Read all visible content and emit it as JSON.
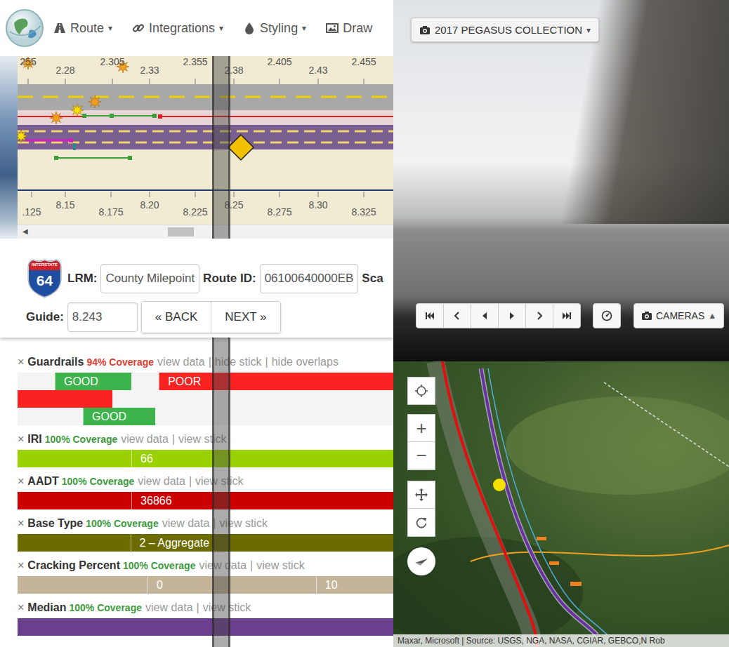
{
  "nav": {
    "menus": [
      {
        "label": "Route",
        "caret": "▾"
      },
      {
        "label": "Integrations",
        "caret": "▾"
      },
      {
        "label": "Styling",
        "caret": "▾"
      },
      {
        "label": "Draw"
      }
    ]
  },
  "diagram": {
    "top_scale": [
      "255",
      "2.28",
      "2.305",
      "2.33",
      "2.355",
      "2.38",
      "2.405",
      "2.43",
      "2.455"
    ],
    "bottom_scale": [
      ".125",
      "8.15",
      "8.175",
      "8.20",
      "8.225",
      "8.25",
      "8.275",
      "8.30",
      "8.325"
    ],
    "scroll_left": "◀",
    "scroll_level": 0.4
  },
  "route": {
    "shield_top": "INTERSTATE",
    "shield_number": "64",
    "lrm_label": "LRM:",
    "lrm_value": "County Milepoint",
    "route_id_label": "Route ID:",
    "route_id_value": "06100640000EB",
    "scale_label": "Sca",
    "guide_label": "Guide:",
    "guide_value": "8.243",
    "back": "« BACK",
    "next": "NEXT »"
  },
  "sticks": [
    {
      "close": "×",
      "name": "Guardrails",
      "coverage": "94% Coverage",
      "coverage_color": "#e03c31",
      "separator": "|",
      "links": [
        "view data",
        "hide stick",
        "hide overlaps"
      ],
      "rows": [
        [
          {
            "from": 0.099,
            "to": 0.303,
            "color": "#3cb44b",
            "text": "GOOD"
          },
          {
            "from": 0.376,
            "to": 1,
            "color": "#fb2222",
            "text": "POOR"
          }
        ],
        [
          {
            "from": 0,
            "to": 0.252,
            "color": "#fb2222"
          }
        ],
        [
          {
            "from": 0.174,
            "to": 0.366,
            "color": "#3cb44b",
            "text": "GOOD"
          }
        ]
      ]
    },
    {
      "close": "×",
      "name": "IRI",
      "coverage": "100% Coverage",
      "coverage_color": "#3c9a3c",
      "separator": "|",
      "links": [
        "view data",
        "view stick"
      ],
      "rows": [
        [
          {
            "from": 0,
            "to": 0.303,
            "color": "#9ad100"
          },
          {
            "from": 0.303,
            "to": 1,
            "color": "#9ad100",
            "text": "66"
          }
        ]
      ]
    },
    {
      "close": "×",
      "name": "AADT",
      "coverage": "100% Coverage",
      "coverage_color": "#3c9a3c",
      "separator": "|",
      "links": [
        "view data",
        "view stick"
      ],
      "rows": [
        [
          {
            "from": 0,
            "to": 0.303,
            "color": "#cc0000"
          },
          {
            "from": 0.303,
            "to": 1,
            "color": "#cc0000",
            "text": "36866"
          }
        ]
      ]
    },
    {
      "close": "×",
      "name": "Base Type",
      "coverage": "100% Coverage",
      "coverage_color": "#3c9a3c",
      "separator": "|",
      "links": [
        "view data",
        "view stick"
      ],
      "rows": [
        [
          {
            "from": 0,
            "to": 0.3,
            "color": "#6b6b00"
          },
          {
            "from": 0.3,
            "to": 1,
            "color": "#6b6b00",
            "text": "2 – Aggregate"
          }
        ]
      ]
    },
    {
      "close": "×",
      "name": "Cracking Percent",
      "coverage": "100% Coverage",
      "coverage_color": "#3c9a3c",
      "separator": "|",
      "links": [
        "view data",
        "view stick"
      ],
      "rows": [
        [
          {
            "from": 0,
            "to": 0.346,
            "color": "#c4b49a"
          },
          {
            "from": 0.346,
            "to": 0.794,
            "color": "#c4b49a",
            "text": "0"
          },
          {
            "from": 0.794,
            "to": 1,
            "color": "#c4b49a",
            "text": "10"
          }
        ]
      ]
    },
    {
      "close": "×",
      "name": "Median",
      "coverage": "100% Coverage",
      "coverage_color": "#3c9a3c",
      "separator": "|",
      "links": [
        "view data",
        "view stick"
      ],
      "rows": [
        [
          {
            "from": 0,
            "to": 1,
            "color": "#6c3f8e"
          }
        ]
      ]
    }
  ],
  "photo": {
    "collection": "2017 PEGASUS COLLECTION",
    "caret": "▾",
    "cameras": "CAMERAS",
    "cameras_caret": "▲"
  },
  "map": {
    "zoom_in": "+",
    "zoom_out": "−",
    "attribution": "Maxar, Microsoft | Source: USGS, NGA, NASA, CGIAR, GEBCO,N Rob"
  }
}
